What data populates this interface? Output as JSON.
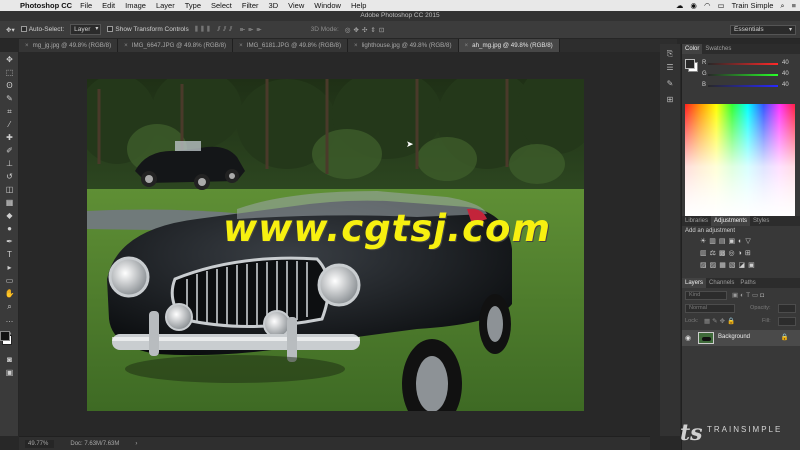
{
  "menubar": {
    "app_name": "Photoshop CC",
    "items": [
      "File",
      "Edit",
      "Image",
      "Layer",
      "Type",
      "Select",
      "Filter",
      "3D",
      "View",
      "Window",
      "Help"
    ],
    "user": "Train Simple"
  },
  "window": {
    "title": "Adobe Photoshop CC 2015"
  },
  "options": {
    "auto_select_label": "Auto-Select:",
    "auto_select_value": "Layer",
    "transform_label": "Show Transform Controls",
    "mode_3d": "3D Mode:",
    "workspace": "Essentials"
  },
  "tabs": [
    {
      "label": "mg_jg.jpg @ 49.8% (RGB/8)",
      "active": false
    },
    {
      "label": "IMG_6647.JPG @ 49.8% (RGB/8)",
      "active": false
    },
    {
      "label": "IMG_6181.JPG @ 49.8% (RGB/8)",
      "active": false
    },
    {
      "label": "lighthouse.jpg @ 49.8% (RGB/8)",
      "active": false
    },
    {
      "label": "ah_mg.jpg @ 49.8% (RGB/8)",
      "active": true
    }
  ],
  "canvas": {
    "watermark": "www.cgtsj.com"
  },
  "status": {
    "zoom": "49.77%",
    "doc": "Doc: 7.63M/7.63M"
  },
  "color_panel": {
    "tabs": [
      "Color",
      "Swatches"
    ],
    "r_label": "R",
    "r_value": "40",
    "g_label": "G",
    "g_value": "40",
    "b_label": "B",
    "b_value": "40"
  },
  "adjust_panel": {
    "tabs": [
      "Libraries",
      "Adjustments",
      "Styles"
    ],
    "add_label": "Add an adjustment"
  },
  "layers_panel": {
    "tabs": [
      "Layers",
      "Channels",
      "Paths"
    ],
    "kind_placeholder": "Kind",
    "blend_mode": "Normal",
    "opacity_label": "Opacity:",
    "lock_label": "Lock:",
    "fill_label": "Fill:",
    "layer_name": "Background"
  },
  "brand": {
    "name": "TRAINSIMPLE"
  },
  "colors": {
    "ps_panel": "#383838",
    "ps_dark": "#282828",
    "watermark": "#f7f010"
  }
}
